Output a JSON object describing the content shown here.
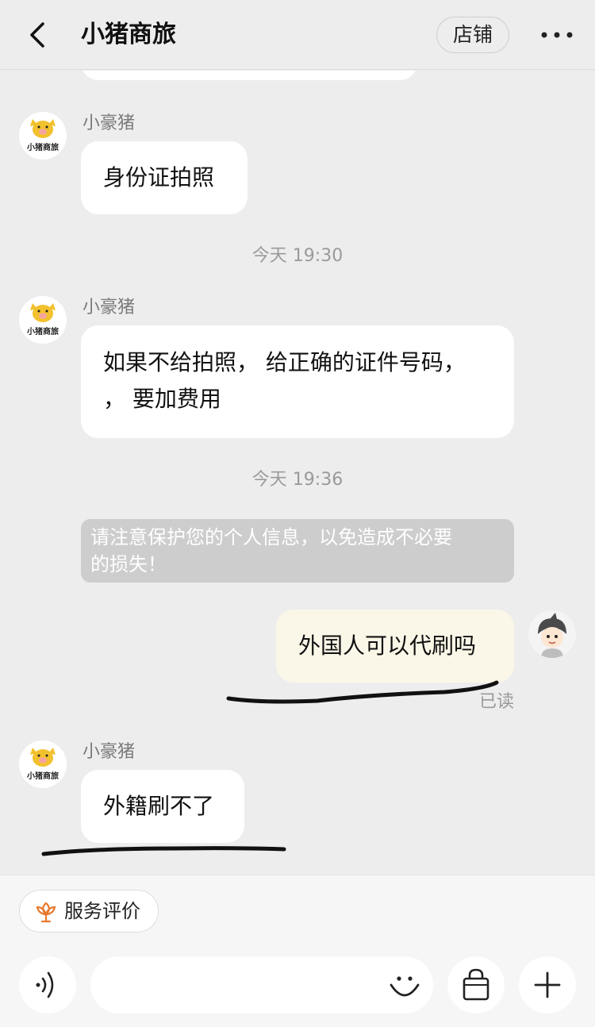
{
  "header": {
    "title": "小猪商旅",
    "shop_label": "店铺"
  },
  "messages": {
    "m1_sender": "小豪猪",
    "m1_text": "身份证拍照",
    "time1": "今天 19:30",
    "m2_sender": "小豪猪",
    "m2_line1": "如果不给拍照，  给正确的证件号码，",
    "m2_line2": "，  要加费用",
    "time2": "今天 19:36",
    "notice_line1": "请注意保护您的个人信息，以免造成不必要",
    "notice_line2": "的损失！",
    "m3_text": "外国人可以代刷吗",
    "m3_status": "已读",
    "m4_sender": "小豪猪",
    "m4_text": "外籍刷不了"
  },
  "avatars": {
    "shop_logo_text": "小猪商旅"
  },
  "bottom": {
    "service_label": "服务评价",
    "input_value": ""
  },
  "colors": {
    "background": "#ededed",
    "own_bubble": "#fbf7e8",
    "notice_bg": "#cdcdcd",
    "accent_orange": "#e8792e"
  },
  "icons": [
    "back-arrow-icon",
    "more-dots-icon",
    "flower-icon",
    "voice-icon",
    "emoji-icon",
    "shopping-bag-icon",
    "plus-icon"
  ]
}
